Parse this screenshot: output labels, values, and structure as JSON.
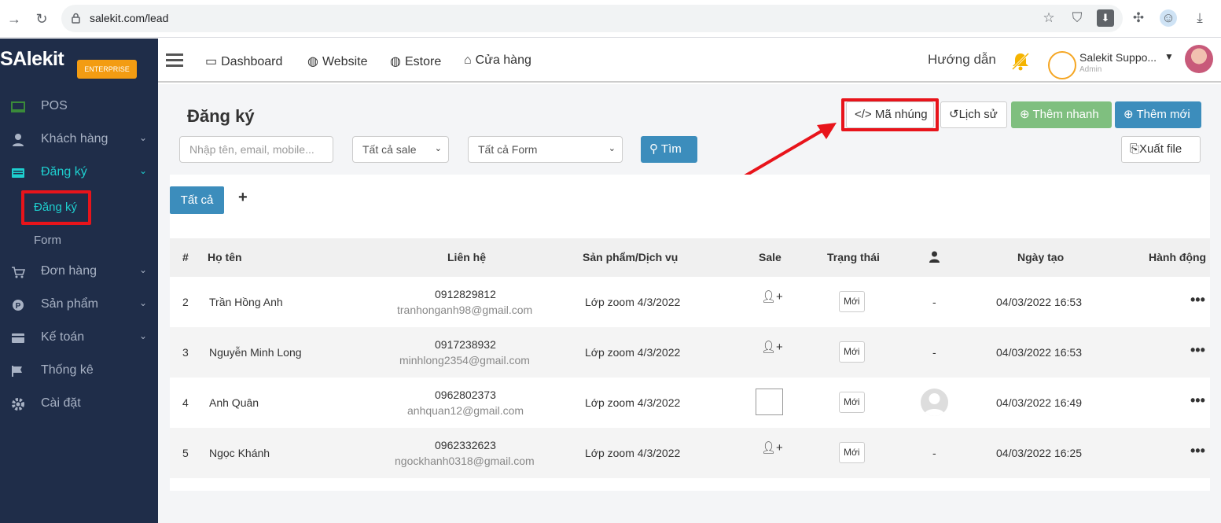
{
  "browser": {
    "url": "salekit.com/lead"
  },
  "sidebar": {
    "logo": "SAlekit",
    "badge": "ENTERPRISE",
    "items": [
      {
        "label": "POS"
      },
      {
        "label": "Khách hàng"
      },
      {
        "label": "Đăng ký"
      },
      {
        "label": "Đơn hàng"
      },
      {
        "label": "Sản phẩm"
      },
      {
        "label": "Kế toán"
      },
      {
        "label": "Thống kê"
      },
      {
        "label": "Cài đặt"
      }
    ],
    "sub_items": [
      {
        "label": "Đăng ký"
      },
      {
        "label": "Form"
      }
    ]
  },
  "topnav": {
    "links": [
      {
        "label": "Dashboard"
      },
      {
        "label": "Website"
      },
      {
        "label": "Estore"
      },
      {
        "label": "Cửa hàng"
      }
    ],
    "help": "Hướng dẫn",
    "user_name": "Salekit Suppo...",
    "user_role": "Admin"
  },
  "page": {
    "title": "Đăng ký",
    "search_placeholder": "Nhập tên, email, mobile...",
    "sale_filter": "Tất cả sale",
    "form_filter": "Tất cả Form",
    "search_btn": "Tìm",
    "embed_btn": "Mã nhúng",
    "history_btn": "Lịch sử",
    "quick_add_btn": "Thêm nhanh",
    "add_new_btn": "Thêm mới",
    "export_btn": "Xuất file",
    "tab_all": "Tất cả",
    "tab_add": "+"
  },
  "table": {
    "headers": [
      "#",
      "Họ tên",
      "Liên hệ",
      "Sản phẩm/Dịch vụ",
      "Sale",
      "Trạng thái",
      "Ngày tạo",
      "Hành động"
    ],
    "rows": [
      {
        "num": "2",
        "name": "Trần Hồng Anh",
        "phone": "0912829812",
        "email": "tranhonganh98@gmail.com",
        "product": "Lớp zoom 4/3/2022",
        "status": "Mới",
        "assignee": "-",
        "created": "04/03/2022 16:53"
      },
      {
        "num": "3",
        "name": "Nguyễn Minh Long",
        "phone": "0917238932",
        "email": "minhlong2354@gmail.com",
        "product": "Lớp zoom 4/3/2022",
        "status": "Mới",
        "assignee": "-",
        "created": "04/03/2022 16:53"
      },
      {
        "num": "4",
        "name": "Anh Quân",
        "phone": "0962802373",
        "email": "anhquan12@gmail.com",
        "product": "Lớp zoom 4/3/2022",
        "status": "Mới",
        "assignee": "",
        "created": "04/03/2022 16:49"
      },
      {
        "num": "5",
        "name": "Ngọc Khánh",
        "phone": "0962332623",
        "email": "ngockhanh0318@gmail.com",
        "product": "Lớp zoom 4/3/2022",
        "status": "Mới",
        "assignee": "-",
        "created": "04/03/2022 16:25"
      }
    ]
  },
  "colors": {
    "sidebar_bg": "#1f2d49",
    "accent_teal": "#1ecfcf",
    "primary_blue": "#3c8dbc",
    "green": "#7fbf7f",
    "highlight_red": "#e8141b"
  }
}
